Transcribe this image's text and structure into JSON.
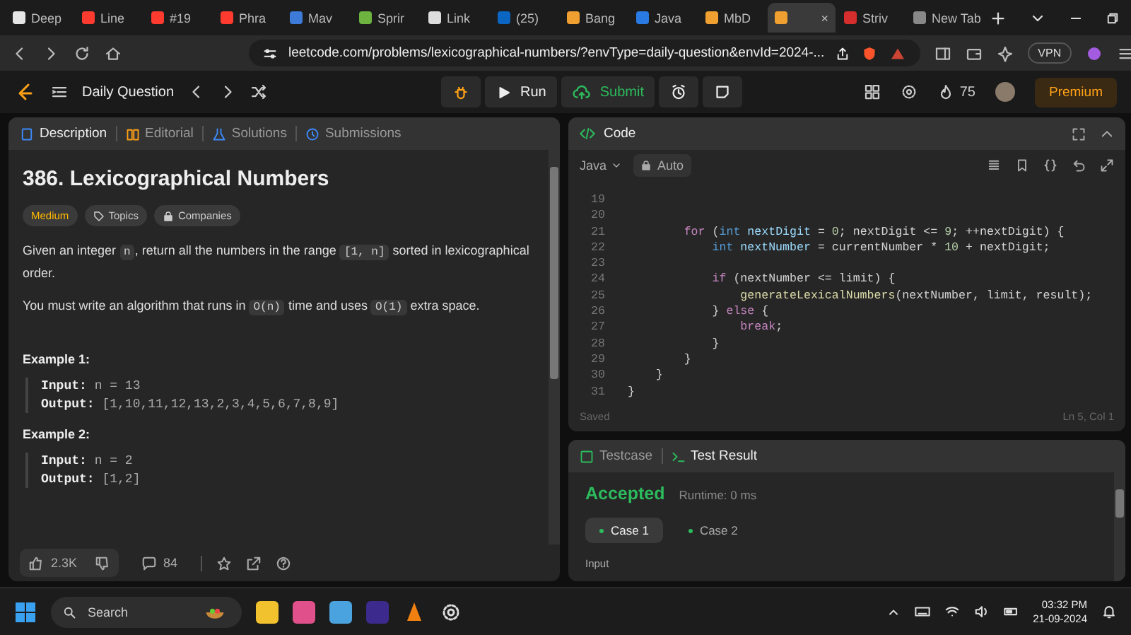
{
  "browser": {
    "tabs": [
      {
        "title": "Deep",
        "selected": false
      },
      {
        "title": "Line",
        "selected": false
      },
      {
        "title": "#19",
        "selected": false
      },
      {
        "title": "Phra",
        "selected": false
      },
      {
        "title": "Mav",
        "selected": false
      },
      {
        "title": "Sprir",
        "selected": false
      },
      {
        "title": "Link",
        "selected": false
      },
      {
        "title": "(25)",
        "selected": false
      },
      {
        "title": "Bang",
        "selected": false
      },
      {
        "title": "Java",
        "selected": false
      },
      {
        "title": "MbD",
        "selected": false
      },
      {
        "title": "×",
        "selected": true
      },
      {
        "title": "Striv",
        "selected": false
      },
      {
        "title": "New Tab",
        "selected": false
      }
    ],
    "address": "leetcode.com/problems/lexicographical-numbers/?envType=daily-question&envId=2024-...",
    "vpn": "VPN"
  },
  "nav": {
    "daily": "Daily Question",
    "run": "Run",
    "submit": "Submit",
    "streak": "75",
    "premium": "Premium"
  },
  "description": {
    "tabs": [
      {
        "label": "Description",
        "selected": true
      },
      {
        "label": "Editorial",
        "selected": false
      },
      {
        "label": "Solutions",
        "selected": false
      },
      {
        "label": "Submissions",
        "selected": false
      }
    ],
    "title": "386. Lexicographical Numbers",
    "difficulty": "Medium",
    "tags": [
      "Topics",
      "Companies"
    ],
    "paragraphs": [
      [
        {
          "kind": "text",
          "text": "Given an integer "
        },
        {
          "kind": "code",
          "text": "n"
        },
        {
          "kind": "text",
          "text": ", return all the numbers in the range "
        },
        {
          "kind": "code",
          "text": "[1, n]"
        },
        {
          "kind": "text",
          "text": " sorted in lexicographical order."
        }
      ],
      [
        {
          "kind": "text",
          "text": "You must write an algorithm that runs in "
        },
        {
          "kind": "code",
          "text": "O(n)"
        },
        {
          "kind": "text",
          "text": " time and uses "
        },
        {
          "kind": "code",
          "text": "O(1)"
        },
        {
          "kind": "text",
          "text": " extra space."
        }
      ]
    ],
    "examples": [
      {
        "title": "Example 1:",
        "lines": [
          {
            "label": "Input:",
            "value": "n = 13"
          },
          {
            "label": "Output:",
            "value": "[1,10,11,12,13,2,3,4,5,6,7,8,9]"
          }
        ]
      },
      {
        "title": "Example 2:",
        "lines": [
          {
            "label": "Input:",
            "value": "n = 2"
          },
          {
            "label": "Output:",
            "value": "[1,2]"
          }
        ]
      }
    ],
    "likes": "2.3K",
    "comments": "84"
  },
  "code": {
    "title": "Code",
    "language": "Java",
    "mode": "Auto",
    "status": "Saved",
    "cursor": "Ln 5, Col 1",
    "lines": [
      {
        "num": "19"
      },
      {
        "num": "20"
      },
      {
        "num": "21",
        "tokens": [
          {
            "kind": "kw",
            "text": "        for"
          },
          {
            "kind": "p",
            "text": " ("
          },
          {
            "kind": "type",
            "text": "int"
          },
          {
            "kind": "var",
            "text": " nextDigit"
          },
          {
            "kind": "p",
            "text": " = "
          },
          {
            "kind": "num",
            "text": "0"
          },
          {
            "kind": "p",
            "text": "; nextDigit <= "
          },
          {
            "kind": "num",
            "text": "9"
          },
          {
            "kind": "p",
            "text": "; ++nextDigit) {"
          }
        ]
      },
      {
        "num": "22",
        "tokens": [
          {
            "kind": "type",
            "text": "            int"
          },
          {
            "kind": "var",
            "text": " nextNumber"
          },
          {
            "kind": "p",
            "text": " = currentNumber * "
          },
          {
            "kind": "num",
            "text": "10"
          },
          {
            "kind": "p",
            "text": " + nextDigit;"
          }
        ]
      },
      {
        "num": "23"
      },
      {
        "num": "24",
        "tokens": [
          {
            "kind": "kw",
            "text": "            if"
          },
          {
            "kind": "p",
            "text": " (nextNumber <= limit) {"
          }
        ]
      },
      {
        "num": "25",
        "tokens": [
          {
            "kind": "fn",
            "text": "                generateLexicalNumbers"
          },
          {
            "kind": "p",
            "text": "(nextNumber, limit, result);"
          }
        ]
      },
      {
        "num": "26",
        "tokens": [
          {
            "kind": "p",
            "text": "            } "
          },
          {
            "kind": "kw",
            "text": "else"
          },
          {
            "kind": "p",
            "text": " {"
          }
        ]
      },
      {
        "num": "27",
        "tokens": [
          {
            "kind": "kw",
            "text": "                break"
          },
          {
            "kind": "p",
            "text": ";"
          }
        ]
      },
      {
        "num": "28",
        "tokens": [
          {
            "kind": "p",
            "text": "            }"
          }
        ]
      },
      {
        "num": "29",
        "tokens": [
          {
            "kind": "p",
            "text": "        }"
          }
        ]
      },
      {
        "num": "30",
        "tokens": [
          {
            "kind": "p",
            "text": "    }"
          }
        ]
      },
      {
        "num": "31",
        "tokens": [
          {
            "kind": "p",
            "text": "}"
          }
        ]
      }
    ]
  },
  "test": {
    "tabs": [
      {
        "label": "Testcase",
        "selected": false
      },
      {
        "label": "Test Result",
        "selected": true
      }
    ],
    "verdict": "Accepted",
    "runtime": "Runtime: 0 ms",
    "cases": [
      {
        "label": "Case 1",
        "selected": true
      },
      {
        "label": "Case 2",
        "selected": false
      }
    ],
    "input_label": "Input"
  },
  "taskbar": {
    "search": "Search",
    "time": "03:32 PM",
    "date": "21-09-2024"
  }
}
